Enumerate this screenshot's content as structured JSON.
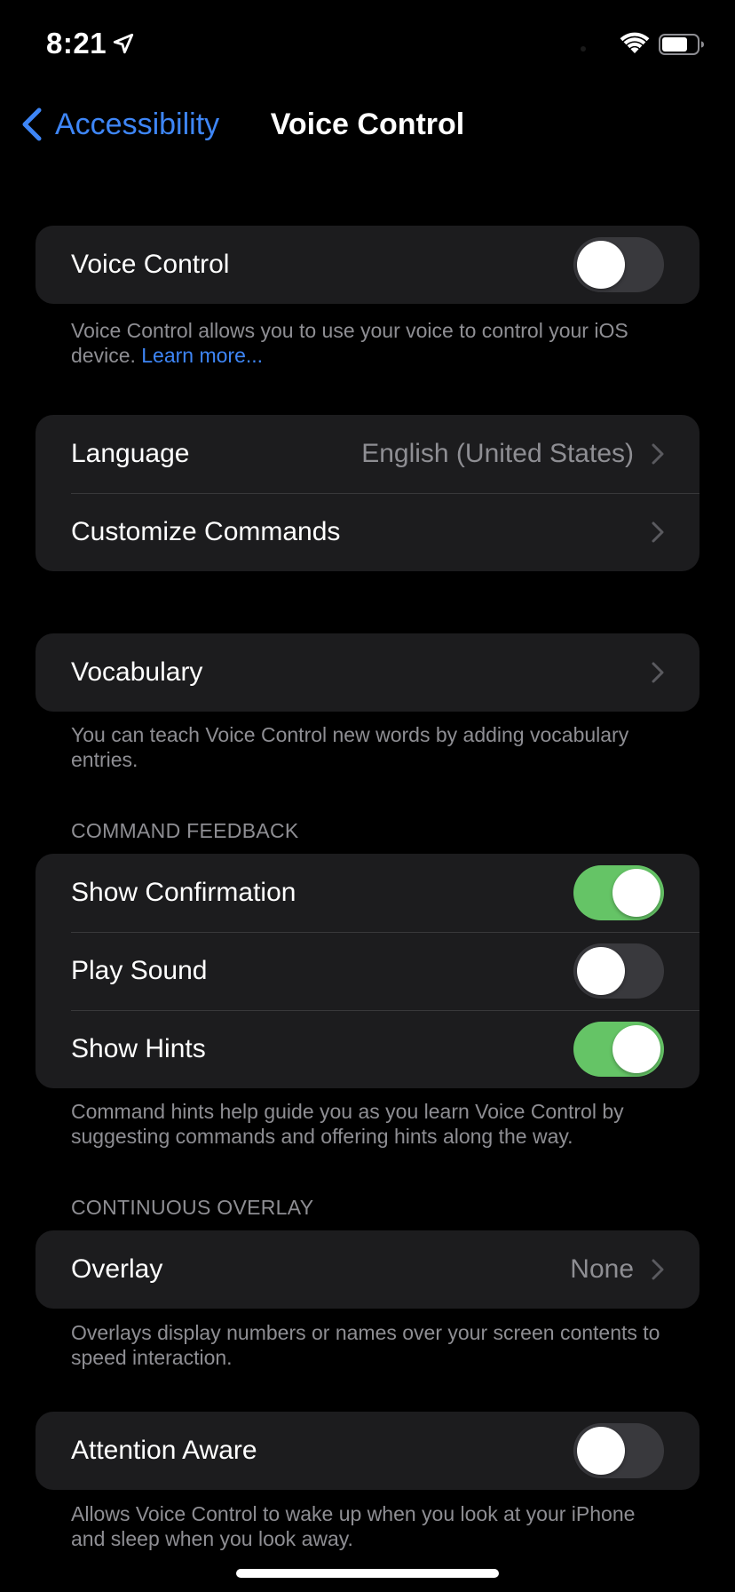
{
  "status_bar": {
    "time": "8:21"
  },
  "nav": {
    "back_label": "Accessibility",
    "title": "Voice Control"
  },
  "voice_control_group": {
    "label": "Voice Control",
    "toggle_on": false
  },
  "voice_control_footer": {
    "text": "Voice Control allows you to use your voice to control your iOS device. ",
    "link": "Learn more..."
  },
  "language_group": {
    "language_label": "Language",
    "language_value": "English (United States)",
    "customize_label": "Customize Commands"
  },
  "vocabulary_group": {
    "label": "Vocabulary"
  },
  "vocabulary_footer": "You can teach Voice Control new words by adding vocabulary entries.",
  "command_feedback": {
    "header": "COMMAND FEEDBACK",
    "show_confirmation": {
      "label": "Show Confirmation",
      "on": true
    },
    "play_sound": {
      "label": "Play Sound",
      "on": false
    },
    "show_hints": {
      "label": "Show Hints",
      "on": true
    },
    "footer": "Command hints help guide you as you learn Voice Control by suggesting commands and offering hints along the way."
  },
  "continuous_overlay": {
    "header": "CONTINUOUS OVERLAY",
    "overlay_label": "Overlay",
    "overlay_value": "None",
    "footer": "Overlays display numbers or names over your screen contents to speed interaction."
  },
  "attention_aware": {
    "label": "Attention Aware",
    "on": false,
    "footer": "Allows Voice Control to wake up when you look at your iPhone and sleep when you look away."
  },
  "colors": {
    "accent": "#3e86f7",
    "toggle_on": "#65c466",
    "toggle_off": "#39393d",
    "cell_bg": "#1c1c1e",
    "secondary_text": "#8e8e93"
  }
}
